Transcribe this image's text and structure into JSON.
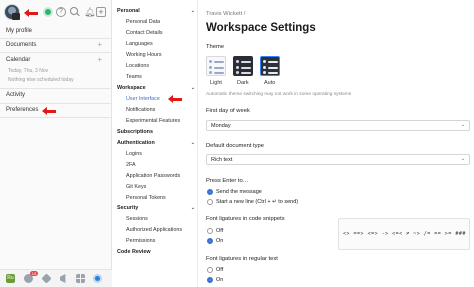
{
  "left_panel": {
    "items": {
      "my_profile": "My profile",
      "documents": "Documents",
      "calendar": "Calendar",
      "calendar_date": "Today, Thu, 3 Nov",
      "calendar_empty": "Nothing else scheduled today",
      "activity": "Activity",
      "preferences": "Preferences"
    },
    "bottom": {
      "chat_badge": "13",
      "app_label": "Ru"
    }
  },
  "settings_nav": {
    "personal": "Personal",
    "personal_items": [
      "Personal Data",
      "Contact Details",
      "Languages",
      "Working Hours",
      "Locations",
      "Teams"
    ],
    "workspace": "Workspace",
    "workspace_items": [
      "User Interface",
      "Notifications",
      "Experimental Features"
    ],
    "subscriptions": "Subscriptions",
    "authentication": "Authentication",
    "auth_items": [
      "Logins",
      "2FA",
      "Application Passwords",
      "Git Keys",
      "Personal Tokens"
    ],
    "security": "Security",
    "security_items": [
      "Sessions",
      "Authorized Applications",
      "Permissions"
    ],
    "code_review": "Code Review"
  },
  "main": {
    "breadcrumb": "Travis Wickett  /",
    "title": "Workspace Settings",
    "theme": {
      "label": "Theme",
      "options": [
        "Light",
        "Dark",
        "Auto"
      ],
      "selected": "Auto",
      "hint": "Automatic theme switching may not work in some operating systems"
    },
    "first_day": {
      "label": "First day of week",
      "value": "Monday"
    },
    "doc_type": {
      "label": "Default document type",
      "value": "Rich text"
    },
    "press_enter": {
      "label": "Press Enter to…",
      "options": [
        "Send the message",
        "Start a new line (Ctrl + ↵ to send)"
      ],
      "selected": 0
    },
    "ligatures_code": {
      "label": "Font ligatures in code snippets",
      "options": [
        "Off",
        "On"
      ],
      "selected": 1,
      "preview": "<> ==> <=> -> <=< ≠ ~> /= == >= ###"
    },
    "ligatures_text": {
      "label": "Font ligatures in regular text",
      "options": [
        "Off",
        "On"
      ],
      "selected": 1
    }
  },
  "colors": {
    "accent": "#3b6fd1",
    "annotation_arrow": "#e01818",
    "status_online": "#2fb36e"
  }
}
